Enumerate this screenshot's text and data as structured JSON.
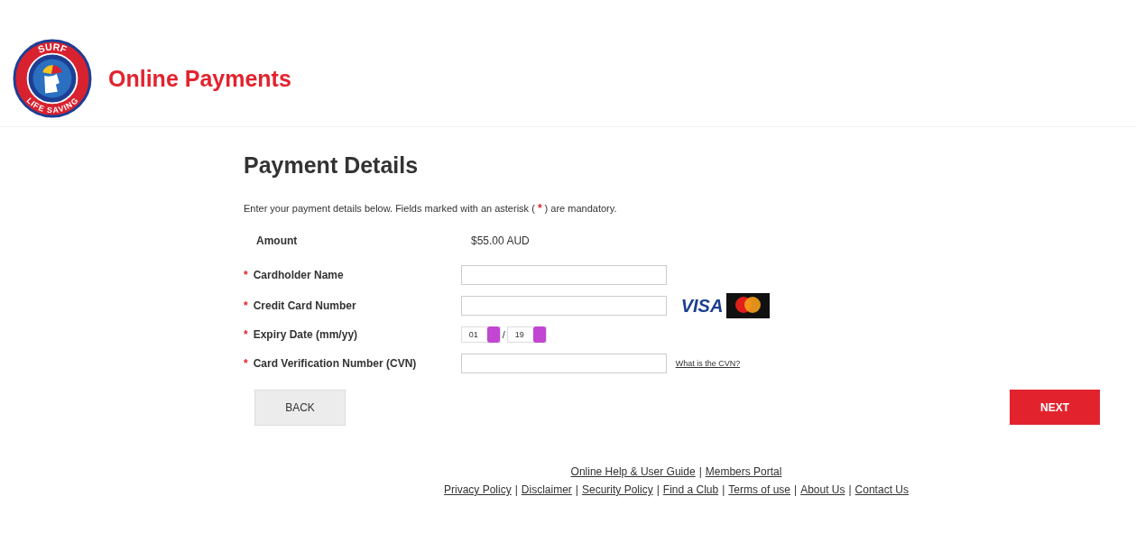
{
  "header": {
    "logo_text_top": "SURF",
    "logo_text_bottom": "LIFE SAVING",
    "title": "Online Payments"
  },
  "page_title": "Payment Details",
  "intro": {
    "before": "Enter your payment details below. Fields marked with an asterisk (",
    "mark": "*",
    "after": ") are mandatory."
  },
  "amount": {
    "label": "Amount",
    "value": "$55.00 AUD"
  },
  "fields": [
    {
      "kind": "text",
      "mark": "*",
      "label": "Cardholder Name"
    },
    {
      "kind": "card",
      "mark": "*",
      "label": "Credit Card Number",
      "card_brand": "VISA"
    },
    {
      "kind": "expiry",
      "mark": "*",
      "label": "Expiry Date (mm/yy)",
      "month": "01",
      "separator": "/",
      "year": "19"
    },
    {
      "kind": "cvn",
      "mark": "*",
      "label": "Card Verification Number (CVN)",
      "link": "What is the CVN?"
    }
  ],
  "buttons": {
    "back": "BACK",
    "next": "NEXT"
  },
  "footer": {
    "row_1": [
      "Online Help & User Guide",
      "Members Portal"
    ],
    "row_2": [
      "Privacy Policy",
      "Disclaimer",
      "Security Policy",
      "Find a Club",
      "Terms of use",
      "About Us",
      "Contact Us"
    ],
    "separator": "|"
  }
}
